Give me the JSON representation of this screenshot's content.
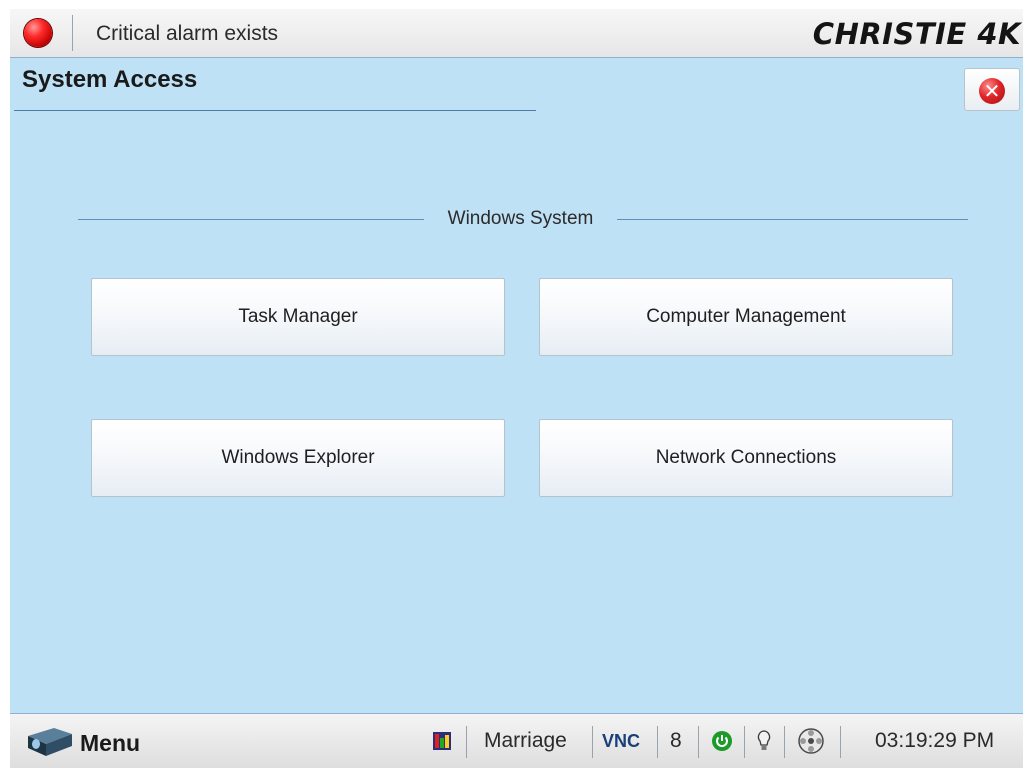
{
  "topbar": {
    "alarm_text": "Critical alarm exists",
    "brand": "CHRISTIE 4K"
  },
  "page": {
    "title": "System Access"
  },
  "section": {
    "title": "Windows System"
  },
  "buttons": {
    "task_manager": "Task Manager",
    "computer_management": "Computer Management",
    "windows_explorer": "Windows Explorer",
    "network_connections": "Network Connections"
  },
  "bottombar": {
    "menu_label": "Menu",
    "source_name": "Marriage",
    "vnc_label": "VNC",
    "channel_number": "8",
    "time": "03:19:29 PM"
  },
  "colors": {
    "background": "#bfe1f6",
    "alarm": "#e01818",
    "power_ok": "#1e9a2a",
    "close": "#d6242a"
  },
  "icons": [
    "alarm-indicator-icon",
    "close-icon",
    "projector-menu-icon",
    "test-pattern-icon",
    "power-icon",
    "lamp-icon",
    "film-reel-icon"
  ]
}
